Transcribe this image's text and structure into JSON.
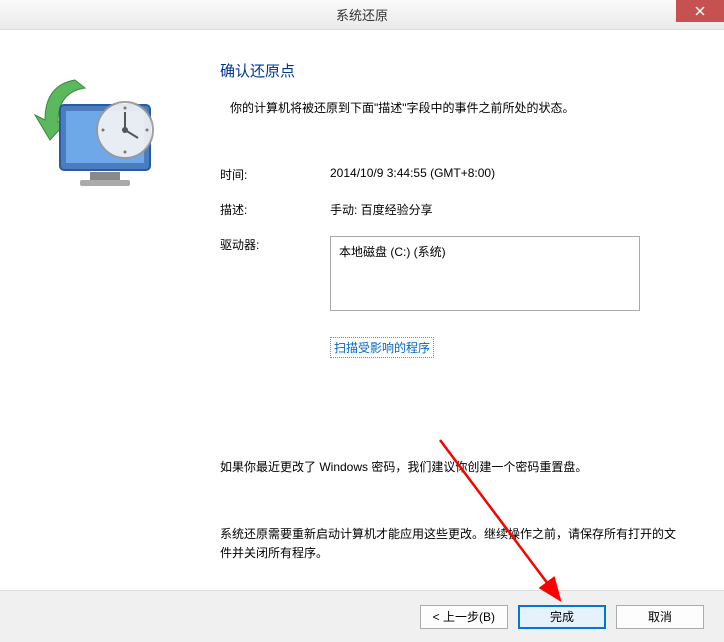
{
  "titlebar": {
    "title": "系统还原"
  },
  "main": {
    "heading": "确认还原点",
    "subtext": "你的计算机将被还原到下面\"描述\"字段中的事件之前所处的状态。",
    "time_label": "时间:",
    "time_value": "2014/10/9 3:44:55 (GMT+8:00)",
    "desc_label": "描述:",
    "desc_value": "手动: 百度经验分享",
    "drive_label": "驱动器:",
    "drive_value": "本地磁盘 (C:) (系统)",
    "scan_link": "扫描受影响的程序",
    "note1": "如果你最近更改了 Windows 密码，我们建议你创建一个密码重置盘。",
    "note2": "系统还原需要重新启动计算机才能应用这些更改。继续操作之前，请保存所有打开的文件并关闭所有程序。"
  },
  "buttons": {
    "back": "< 上一步(B)",
    "finish": "完成",
    "cancel": "取消"
  }
}
